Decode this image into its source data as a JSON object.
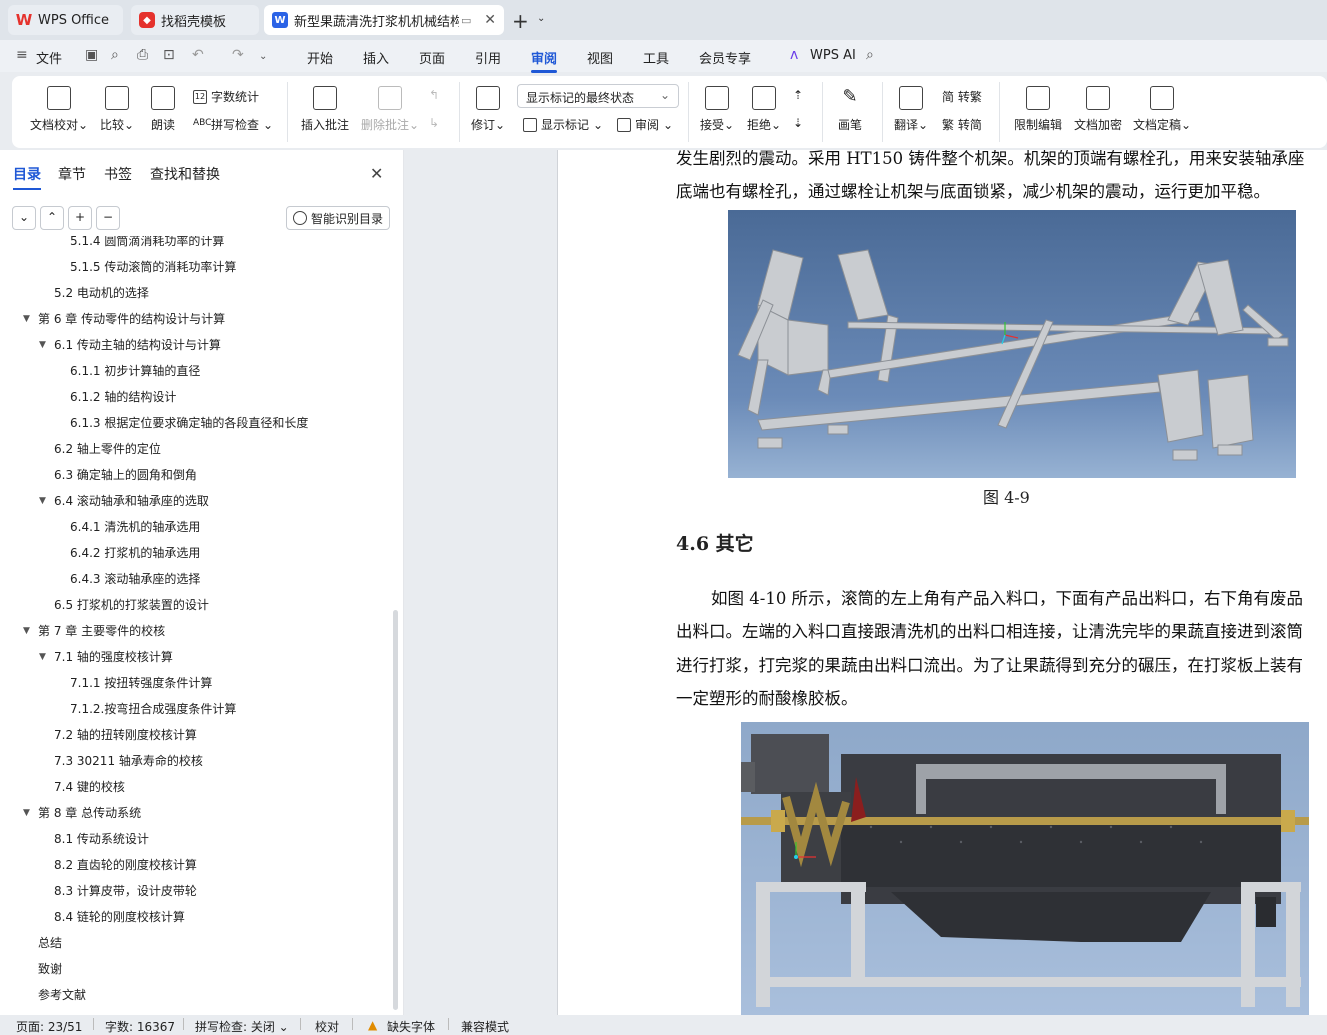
{
  "tabs": [
    {
      "label": "WPS Office"
    },
    {
      "label": "找稻壳模板"
    },
    {
      "label": "新型果蔬清洗打浆机机械结构设计"
    }
  ],
  "menu": {
    "file": "文件",
    "items": [
      "开始",
      "插入",
      "页面",
      "引用",
      "审阅",
      "视图",
      "工具",
      "会员专享"
    ],
    "active": "审阅",
    "ai": "WPS AI"
  },
  "ribbon": {
    "doc_check": "文档校对",
    "compare": "比较",
    "read_aloud": "朗读",
    "word_count": "字数统计",
    "spell_check": "拼写检查",
    "insert_comment": "插入批注",
    "delete_comment": "删除批注",
    "revise": "修订",
    "display_state": "显示标记的最终状态",
    "show_markup": "显示标记",
    "review": "审阅",
    "accept": "接受",
    "reject": "拒绝",
    "pen": "画笔",
    "translate": "翻译",
    "to_traditional": "简 转繁",
    "to_simplified": "繁 转简",
    "restrict_edit": "限制编辑",
    "encrypt": "文档加密",
    "finalize": "文档定稿"
  },
  "left_pane": {
    "tabs": [
      "目录",
      "章节",
      "书签",
      "查找和替换"
    ],
    "smart_btn": "智能识别目录",
    "toc": [
      {
        "label": "5.1.4 圆筒滴消耗功率的计算",
        "level": 3
      },
      {
        "label": "5.1.5 传动滚筒的消耗功率计算",
        "level": 3
      },
      {
        "label": "5.2 电动机的选择",
        "level": 2
      },
      {
        "label": "第 6 章  传动零件的结构设计与计算",
        "level": 1,
        "expanded": true
      },
      {
        "label": "6.1 传动主轴的结构设计与计算",
        "level": 2,
        "expanded": true
      },
      {
        "label": "6.1.1 初步计算轴的直径",
        "level": 3
      },
      {
        "label": "6.1.2 轴的结构设计",
        "level": 3
      },
      {
        "label": "6.1.3  根据定位要求确定轴的各段直径和长度",
        "level": 3
      },
      {
        "label": "6.2 轴上零件的定位",
        "level": 2
      },
      {
        "label": "6.3 确定轴上的圆角和倒角",
        "level": 2
      },
      {
        "label": "6.4 滚动轴承和轴承座的选取",
        "level": 2,
        "expanded": true
      },
      {
        "label": "6.4.1 清洗机的轴承选用",
        "level": 3
      },
      {
        "label": "6.4.2 打浆机的轴承选用",
        "level": 3
      },
      {
        "label": "6.4.3 滚动轴承座的选择",
        "level": 3
      },
      {
        "label": "6.5 打浆机的打浆装置的设计",
        "level": 2
      },
      {
        "label": "第 7 章  主要零件的校核",
        "level": 1,
        "expanded": true
      },
      {
        "label": "7.1 轴的强度校核计算",
        "level": 2,
        "expanded": true
      },
      {
        "label": "7.1.1 按扭转强度条件计算",
        "level": 3
      },
      {
        "label": "7.1.2.按弯扭合成强度条件计算",
        "level": 3
      },
      {
        "label": "7.2 轴的扭转刚度校核计算",
        "level": 2
      },
      {
        "label": "7.3 30211 轴承寿命的校核",
        "level": 2
      },
      {
        "label": "7.4 键的校核",
        "level": 2
      },
      {
        "label": "第 8 章  总传动系统",
        "level": 1,
        "expanded": true
      },
      {
        "label": "8.1 传动系统设计",
        "level": 2
      },
      {
        "label": "8.2 直齿轮的刚度校核计算",
        "level": 2
      },
      {
        "label": "8.3 计算皮带，设计皮带轮",
        "level": 2
      },
      {
        "label": "8.4 链轮的刚度校核计算",
        "level": 2
      },
      {
        "label": "总结",
        "level": 1
      },
      {
        "label": "致谢",
        "level": 1
      },
      {
        "label": "参考文献",
        "level": 1
      }
    ]
  },
  "document": {
    "para1_line1": "发生剧烈的震动。采用 HT150 铸件整个机架。机架的顶端有螺栓孔，用来安装轴承座",
    "para1_line2": "底端也有螺栓孔，通过螺栓让机架与底面锁紧，减少机架的震动，运行更加平稳。",
    "fig1_caption": "图 4-9",
    "heading": "4.6 其它",
    "para2_lines": [
      "如图 4-10 所示，滚筒的左上角有产品入料口，下面有产品出料口，右下角有废品",
      "出料口。左端的入料口直接跟清洗机的出料口相连接，让清洗完毕的果蔬直接进到滚筒",
      "进行打浆，打完浆的果蔬由出料口流出。为了让果蔬得到充分的碾压，在打浆板上装有",
      "一定塑形的耐酸橡胶板。"
    ]
  },
  "status": {
    "page": "页面: 23/51",
    "words": "字数: 16367",
    "spell": "拼写检查: 关闭",
    "proof": "校对",
    "missing_font": "缺失字体",
    "compat": "兼容模式"
  }
}
